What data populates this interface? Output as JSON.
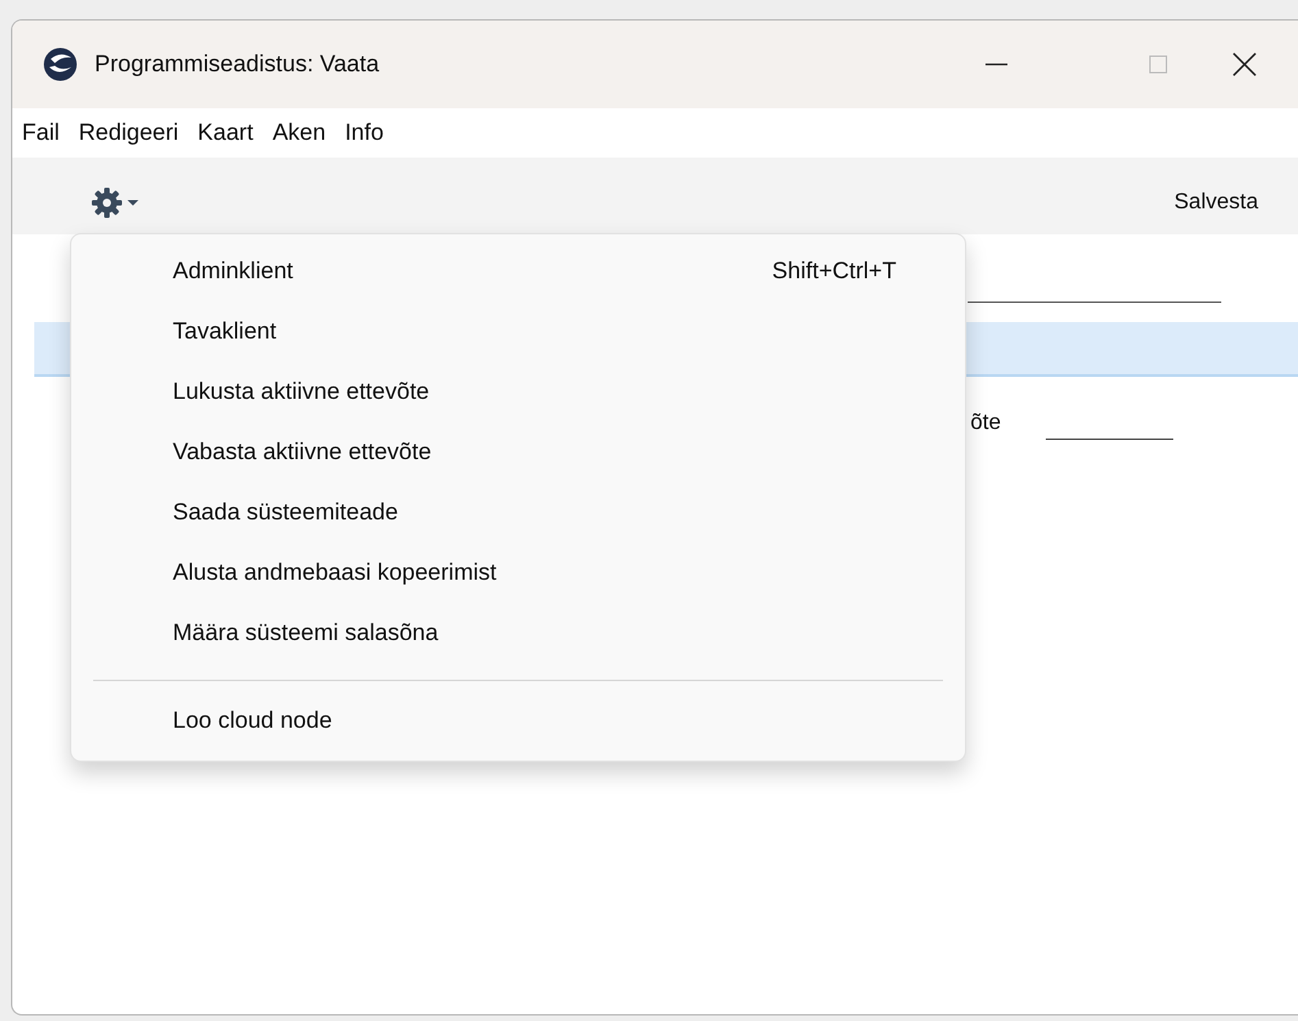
{
  "window": {
    "title": "Programmiseadistus: Vaata"
  },
  "menubar": [
    {
      "label": "Fail"
    },
    {
      "label": "Redigeeri"
    },
    {
      "label": "Kaart"
    },
    {
      "label": "Aken"
    },
    {
      "label": "Info"
    }
  ],
  "toolbar": {
    "save_button": "Salvesta"
  },
  "form": {
    "field_label": "õte"
  },
  "menu": {
    "items": [
      {
        "kind": "item",
        "label": "Adminklient",
        "shortcut": "Shift+Ctrl+T"
      },
      {
        "kind": "item",
        "label": "Tavaklient"
      },
      {
        "kind": "item",
        "label": "Lukusta aktiivne ettevõte"
      },
      {
        "kind": "item",
        "label": "Vabasta aktiivne ettevõte"
      },
      {
        "kind": "item",
        "label": "Saada süsteemiteade"
      },
      {
        "kind": "item",
        "label": "Alusta andmebaasi kopeerimist"
      },
      {
        "kind": "item",
        "label": "Määra süsteemi salasõna"
      },
      {
        "kind": "separator"
      },
      {
        "kind": "item",
        "label": "Loo cloud node"
      }
    ]
  }
}
